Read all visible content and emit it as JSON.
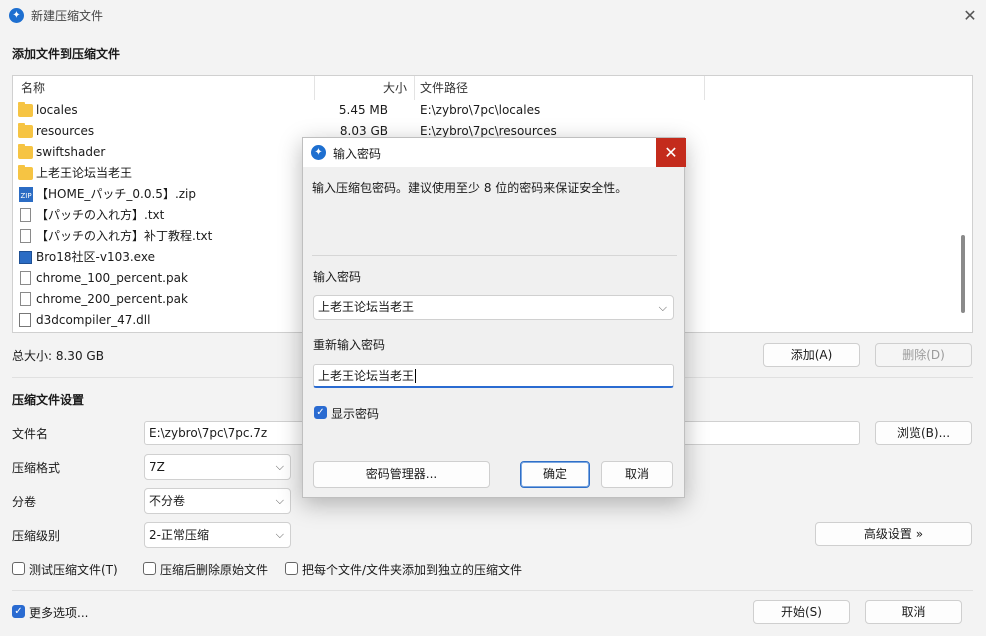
{
  "window": {
    "title": "新建压缩文件",
    "icon": "app-icon",
    "close": "✕"
  },
  "files_section": {
    "label": "添加文件到压缩文件",
    "columns": {
      "name": "名称",
      "size": "大小",
      "path": "文件路径"
    },
    "rows": [
      {
        "icon": "folder-icon",
        "name": "locales",
        "size": "5.45 MB",
        "path": "E:\\zybro\\7pc\\locales"
      },
      {
        "icon": "folder-icon",
        "name": "resources",
        "size": "8.03 GB",
        "path": "E:\\zybro\\7pc\\resources"
      },
      {
        "icon": "folder-icon",
        "name": "swiftshader",
        "size": "",
        "path": ""
      },
      {
        "icon": "folder-icon",
        "name": "上老王论坛当老王",
        "size": "",
        "path": ""
      },
      {
        "icon": "zip-icon",
        "name": "【HOME_パッチ_0.0.5】.zip",
        "size": "",
        "path": ""
      },
      {
        "icon": "text-file-icon",
        "name": "【パッチの入れ方】.txt",
        "size": "",
        "path": ""
      },
      {
        "icon": "text-file-icon",
        "name": "【パッチの入れ方】补丁教程.txt",
        "size": "",
        "path": ""
      },
      {
        "icon": "exe-icon",
        "name": "Bro18社区-v103.exe",
        "size": "",
        "path": ""
      },
      {
        "icon": "file-icon",
        "name": "chrome_100_percent.pak",
        "size": "",
        "path": ""
      },
      {
        "icon": "file-icon",
        "name": "chrome_200_percent.pak",
        "size": "",
        "path": ""
      },
      {
        "icon": "dll-icon",
        "name": "d3dcompiler_47.dll",
        "size": "",
        "path": ""
      }
    ],
    "total": "总大小: 8.30 GB",
    "add_button": "添加(A)",
    "delete_button": "删除(D)"
  },
  "settings": {
    "label": "压缩文件设置",
    "filename_label": "文件名",
    "filename_value": "E:\\zybro\\7pc\\7pc.7z",
    "browse_button": "浏览(B)...",
    "format_label": "压缩格式",
    "format_value": "7Z",
    "volume_label": "分卷",
    "volume_value": "不分卷",
    "level_label": "压缩级别",
    "level_value": "2-正常压缩",
    "advanced_button": "高级设置 »",
    "test_check": "测试压缩文件(T)",
    "delete_after_check": "压缩后删除原始文件",
    "each_separate_check": "把每个文件/文件夹添加到独立的压缩文件",
    "more_options_check": "更多选项...",
    "start_button": "开始(S)",
    "cancel_button": "取消"
  },
  "dialog": {
    "title": "输入密码",
    "hint": "输入压缩包密码。建议使用至少 8 位的密码来保证安全性。",
    "password_label": "输入密码",
    "password_value": "上老王论坛当老王",
    "reenter_label": "重新输入密码",
    "reenter_value": "上老王论坛当老王",
    "show_password": "显示密码",
    "manager_button": "密码管理器...",
    "ok_button": "确定",
    "cancel_button": "取消"
  },
  "colors": {
    "accent": "#2a6bd1",
    "close_red": "#c42b1c",
    "folder": "#f6c443"
  }
}
